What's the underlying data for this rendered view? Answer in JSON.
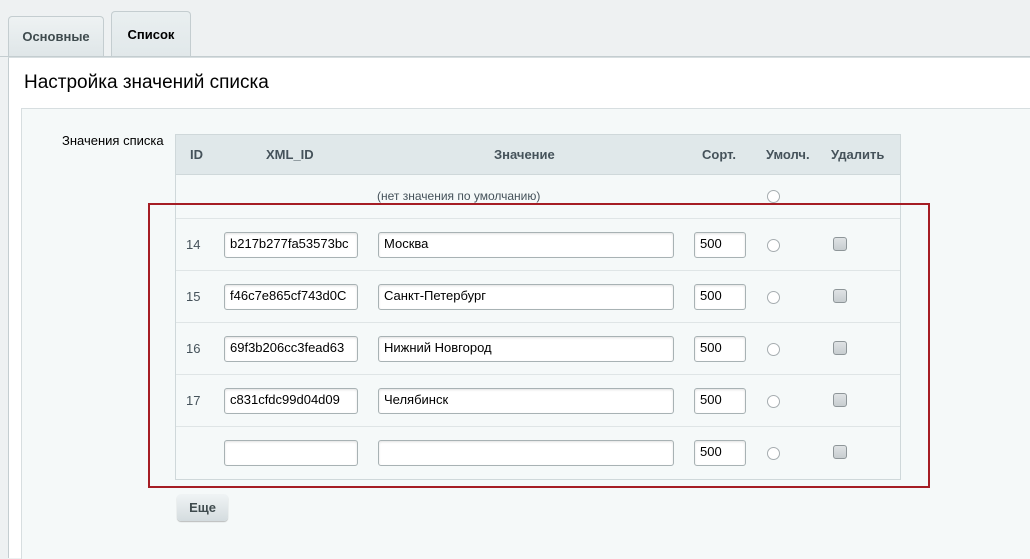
{
  "tabs": [
    {
      "label": "Основные"
    },
    {
      "label": "Список"
    }
  ],
  "page_title": "Настройка значений списка",
  "field_label": "Значения списка",
  "table": {
    "headers": {
      "id": "ID",
      "xml_id": "XML_ID",
      "value": "Значение",
      "sort": "Сорт.",
      "default": "Умолч.",
      "delete": "Удалить"
    },
    "no_default_text": "(нет значения по умолчанию)",
    "rows": [
      {
        "id": "14",
        "xml_id": "b217b277fa53573bc",
        "value": "Москва",
        "sort": "500"
      },
      {
        "id": "15",
        "xml_id": "f46c7e865cf743d0C",
        "value": "Санкт-Петербург",
        "sort": "500"
      },
      {
        "id": "16",
        "xml_id": "69f3b206cc3fead63",
        "value": "Нижний Новгород",
        "sort": "500"
      },
      {
        "id": "17",
        "xml_id": "c831cfdc99d04d09",
        "value": "Челябинск",
        "sort": "500"
      },
      {
        "id": "",
        "xml_id": "",
        "value": "",
        "sort": "500"
      }
    ]
  },
  "more_button": "Еще",
  "colors": {
    "highlight": "#a51d24",
    "background": "#eef1f2",
    "header_bg": "#e0e8ea"
  }
}
